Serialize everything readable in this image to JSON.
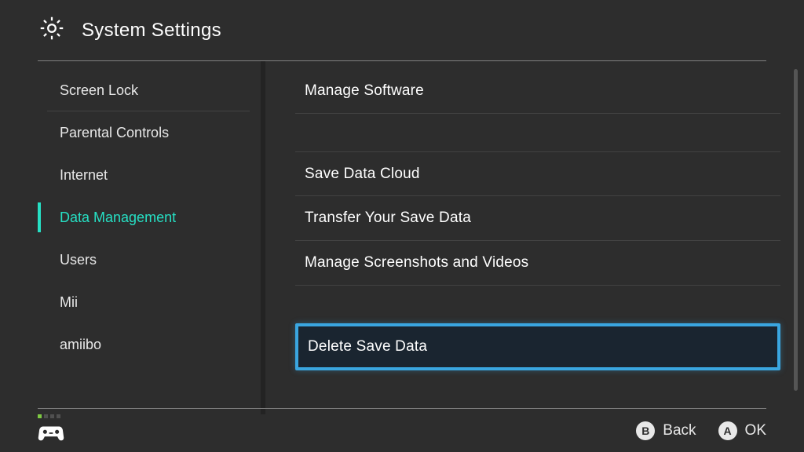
{
  "header": {
    "title": "System Settings"
  },
  "sidebar": {
    "items": [
      {
        "label": "Screen Lock",
        "selected": false,
        "divider": true
      },
      {
        "label": "Parental Controls",
        "selected": false,
        "divider": false
      },
      {
        "label": "Internet",
        "selected": false,
        "divider": false
      },
      {
        "label": "Data Management",
        "selected": true,
        "divider": false
      },
      {
        "label": "Users",
        "selected": false,
        "divider": false
      },
      {
        "label": "Mii",
        "selected": false,
        "divider": false
      },
      {
        "label": "amiibo",
        "selected": false,
        "divider": false
      }
    ]
  },
  "main": {
    "options": [
      {
        "label": "Manage Software",
        "highlighted": false,
        "first": false,
        "gapAfter": true
      },
      {
        "label": "Save Data Cloud",
        "highlighted": false,
        "first": true,
        "gapAfter": false
      },
      {
        "label": "Transfer Your Save Data",
        "highlighted": false,
        "first": false,
        "gapAfter": false
      },
      {
        "label": "Manage Screenshots and Videos",
        "highlighted": false,
        "first": false,
        "gapAfter": false
      },
      {
        "label": "Delete Save Data",
        "highlighted": true,
        "first": false,
        "gapAfter": false
      }
    ]
  },
  "footer": {
    "hints": [
      {
        "button": "B",
        "label": "Back"
      },
      {
        "button": "A",
        "label": "OK"
      }
    ]
  },
  "colors": {
    "accent": "#26e0c4",
    "highlight": "#3aa6e0"
  }
}
